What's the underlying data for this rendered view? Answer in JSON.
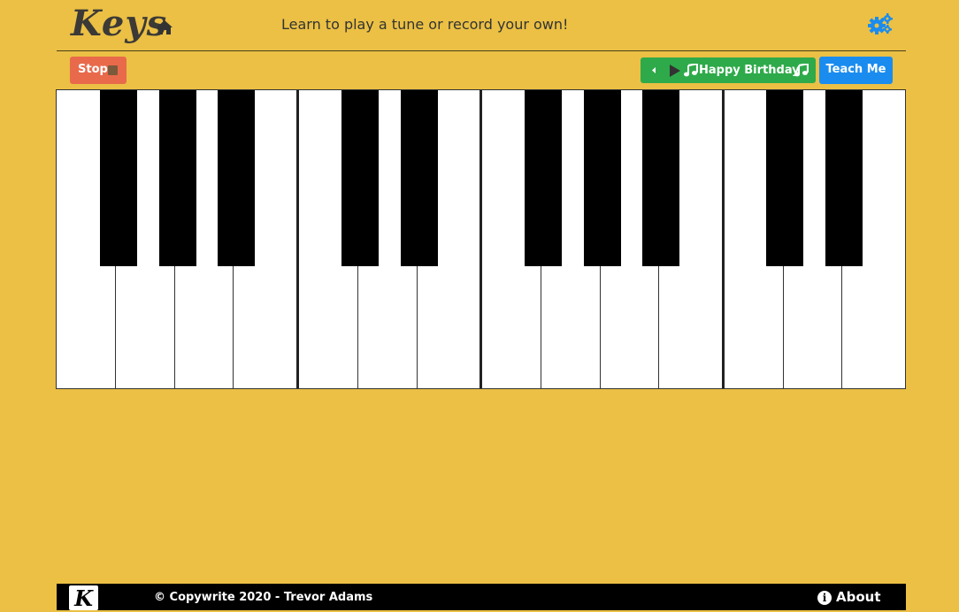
{
  "header": {
    "logo": "Keys",
    "tagline": "Learn to play a tune or record your own!",
    "home_icon": "home-icon",
    "settings_icon": "gears-icon"
  },
  "controls": {
    "stop_label": "Stop",
    "song_title": "Happy Birthday",
    "teach_label": "Teach Me",
    "colors": {
      "stop": "#e86a4b",
      "song": "#2eaa4a",
      "teach": "#1a8cf0"
    }
  },
  "piano": {
    "white_keys": 14,
    "black_keys": 10
  },
  "footer": {
    "logo": "K",
    "copyright": "© Copywrite 2020 - Trevor Adams",
    "about_label": "About"
  },
  "colors": {
    "background": "#ebc044",
    "footer": "#000000"
  }
}
